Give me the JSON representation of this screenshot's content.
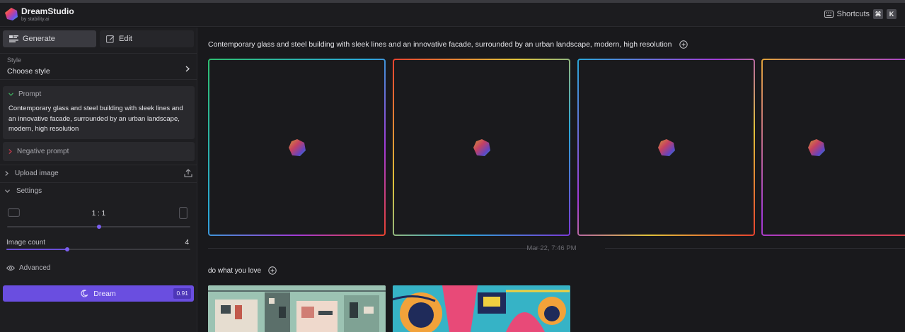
{
  "app": {
    "name": "DreamStudio",
    "subtitle": "by stability.ai"
  },
  "header": {
    "shortcuts_label": "Shortcuts",
    "shortcut_keys": [
      "⌘",
      "K"
    ]
  },
  "sidebar": {
    "tabs": [
      {
        "label": "Generate",
        "icon": "generate-icon",
        "active": true
      },
      {
        "label": "Edit",
        "icon": "edit-icon",
        "active": false
      }
    ],
    "style": {
      "label": "Style",
      "value": "Choose style"
    },
    "prompt": {
      "title": "Prompt",
      "text": "Contemporary glass and steel building with sleek lines and an innovative facade, surrounded by an urban landscape, modern, high resolution"
    },
    "negative_prompt": {
      "title": "Negative prompt"
    },
    "upload_image": {
      "label": "Upload image"
    },
    "settings": {
      "label": "Settings",
      "aspect_ratio": "1 : 1",
      "aspect_ratio_position": 0.5,
      "image_count_label": "Image count",
      "image_count_value": "4",
      "image_count_position": 0.33
    },
    "advanced": {
      "label": "Advanced"
    },
    "dream_button": {
      "label": "Dream",
      "cost": "0.91"
    }
  },
  "main": {
    "generation": {
      "prompt": "Contemporary glass and steel building with sleek lines and an innovative facade, surrounded by an urban landscape, modern, high resolution",
      "image_count": 4,
      "state": "loading"
    },
    "date_separator": "Mar 22, 7:46 PM",
    "previous": {
      "prompt": "do what you love",
      "thumbnails": 2
    }
  },
  "colors": {
    "accent": "#6a4ee0",
    "background": "#19191c",
    "sidebar": "#1e1e21"
  }
}
